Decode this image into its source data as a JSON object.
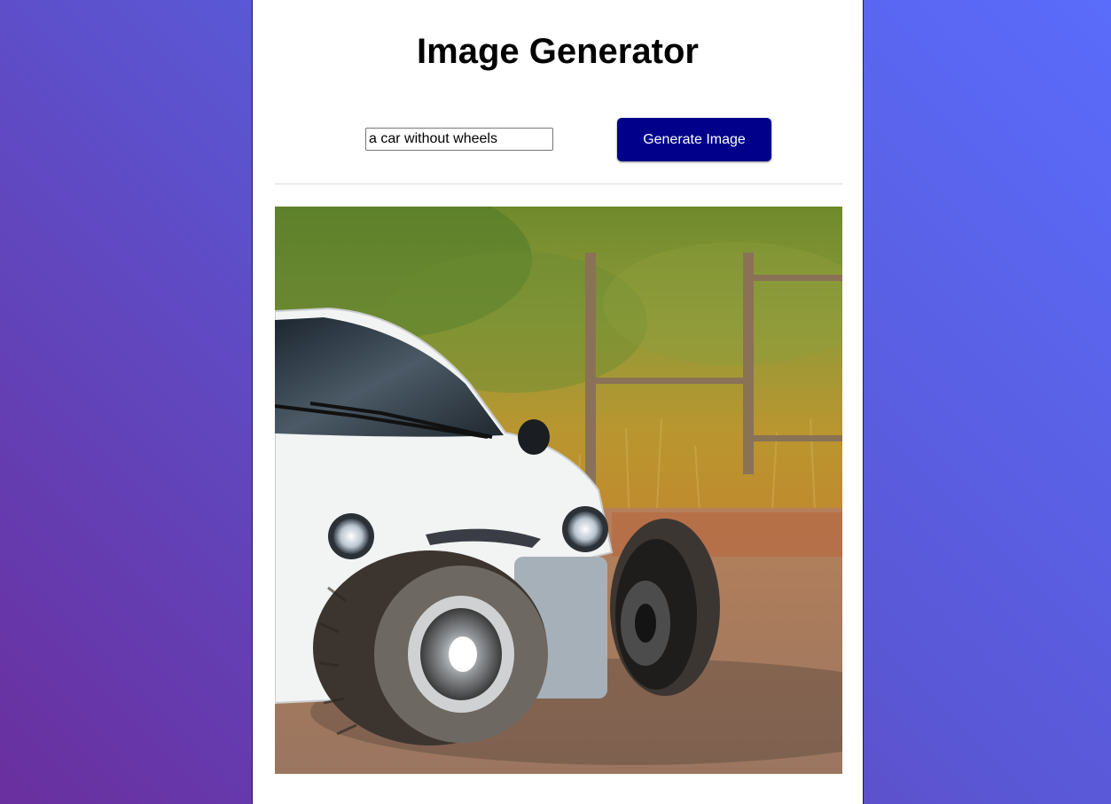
{
  "page": {
    "title": "Image Generator"
  },
  "form": {
    "prompt_value": "a car without wheels",
    "generate_label": "Generate Image",
    "button_color": "#00008b"
  },
  "result": {
    "image_subject": "car-with-wheels-photo"
  },
  "colors": {
    "background_start": "#6a2f9e",
    "background_end": "#5a6cfb",
    "panel": "#ffffff"
  }
}
